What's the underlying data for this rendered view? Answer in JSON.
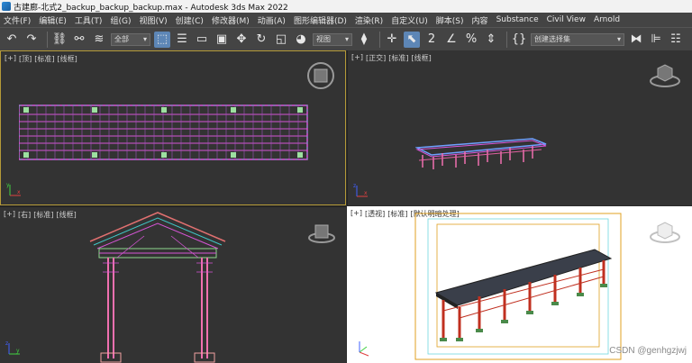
{
  "window": {
    "title": "古建廊-北式2_backup_backup_backup.max - Autodesk 3ds Max 2022"
  },
  "menu": [
    "文件(F)",
    "编辑(E)",
    "工具(T)",
    "组(G)",
    "视图(V)",
    "创建(C)",
    "修改器(M)",
    "动画(A)",
    "图形编辑器(D)",
    "渲染(R)",
    "自定义(U)",
    "脚本(S)",
    "内容",
    "Substance",
    "Civil View",
    "Arnold"
  ],
  "toolbar": {
    "filter_select": "全部",
    "coord_select": "视图",
    "selection_set": "创建选择集"
  },
  "viewports": {
    "top": {
      "plus": "[+]",
      "name": "[顶]",
      "shading": "[标准]",
      "style": "[线框]"
    },
    "front": {
      "plus": "[+]",
      "name": "[正交]",
      "shading": "[标准]",
      "style": "[线框]"
    },
    "left": {
      "plus": "[+]",
      "name": "[右]",
      "shading": "[标准]",
      "style": "[线框]"
    },
    "persp": {
      "plus": "[+]",
      "name": "[透视]",
      "shading": "[标准]",
      "style": "[默认明暗处理]"
    }
  },
  "watermark": "CSDN @genhgzjwj",
  "colors": {
    "wire_magenta": "#d655d6",
    "wire_pink": "#f070b0",
    "wire_cyan": "#40c8c8",
    "wire_green": "#8fd88f",
    "frame_yellow": "#e0a020",
    "frame_cyan": "#6fd8e0",
    "roof_dark": "#3a3f4a",
    "column_red": "#c03020",
    "base_green": "#4a8a4a"
  }
}
